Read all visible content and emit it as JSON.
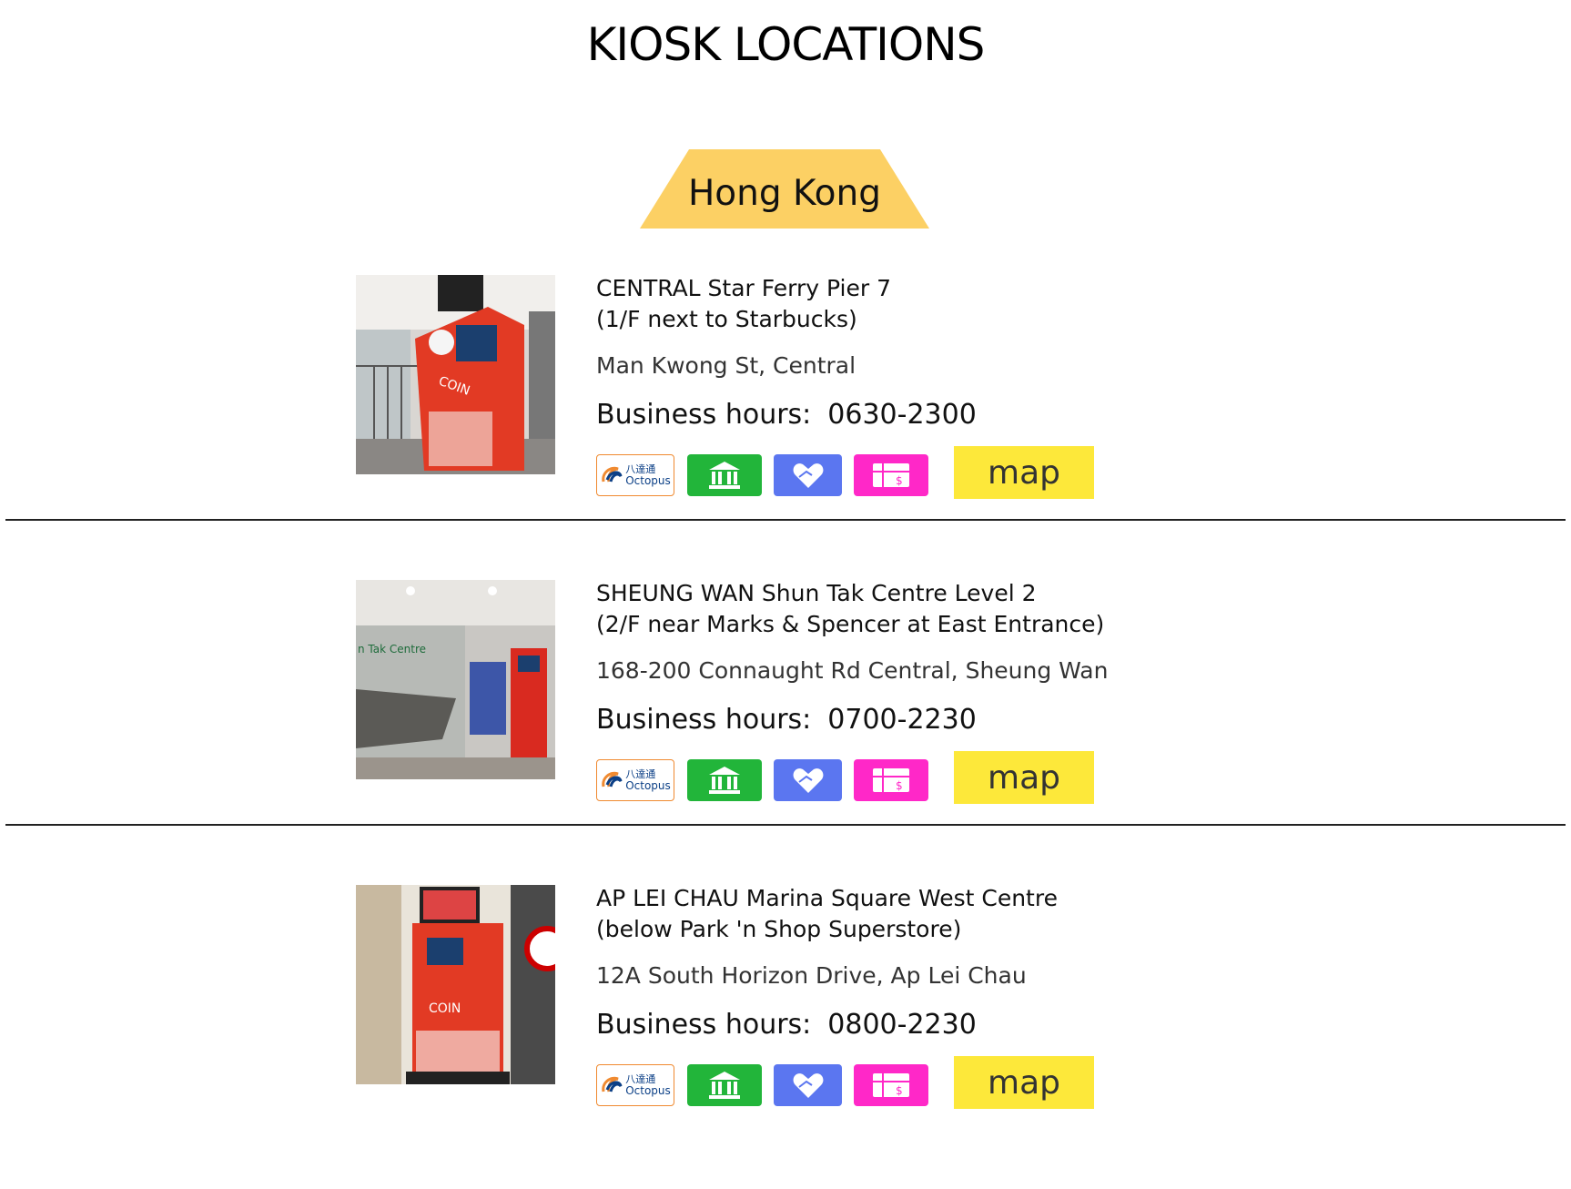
{
  "page": {
    "title": "KIOSK LOCATIONS"
  },
  "region": {
    "label": "Hong Kong",
    "tab_color": "#fcd064"
  },
  "payment_icons": {
    "octopus_logo_text_cn": "八達通",
    "octopus_logo_text_en": "Octopus",
    "colors": {
      "bank": "#22b53a",
      "donate": "#5b76f0",
      "gift": "#ff28c8",
      "map_button": "#fde83a"
    },
    "icons": [
      "octopus-logo",
      "bank-icon",
      "heart-hand-icon",
      "gift-card-icon"
    ]
  },
  "kiosks": [
    {
      "name_line1": "CENTRAL Star Ferry Pier 7",
      "name_line2": "(1/F next to Starbucks)",
      "address": "Man Kwong St, Central",
      "hours_label": "Business hours:",
      "hours_value": "0630-2300",
      "map_label": "map"
    },
    {
      "name_line1": "SHEUNG WAN Shun Tak Centre Level 2",
      "name_line2": "(2/F near Marks & Spencer at East Entrance)",
      "address": "168-200 Connaught Rd Central, Sheung Wan",
      "hours_label": "Business hours:",
      "hours_value": "0700-2230",
      "map_label": "map"
    },
    {
      "name_line1": "AP LEI CHAU Marina Square West Centre",
      "name_line2": "(below Park 'n Shop Superstore)",
      "address": "12A South Horizon Drive, Ap Lei Chau",
      "hours_label": "Business hours:",
      "hours_value": "0800-2230",
      "map_label": "map"
    }
  ]
}
